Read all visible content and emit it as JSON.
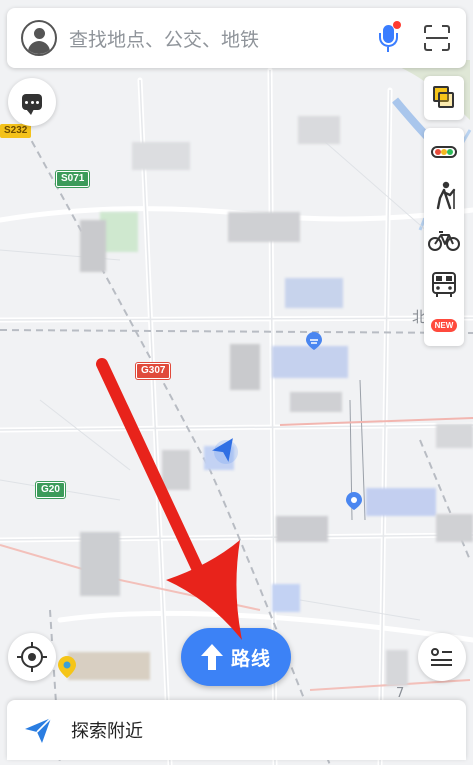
{
  "search": {
    "placeholder": "查找地点、公交、地铁"
  },
  "map": {
    "road_shields": [
      {
        "label": "S232",
        "style": "yellow"
      },
      {
        "label": "S071",
        "style": "green"
      },
      {
        "label": "G307",
        "style": "red"
      },
      {
        "label": "G20",
        "style": "green"
      }
    ],
    "visible_labels": [
      "北",
      "7"
    ]
  },
  "toolbar": {
    "new_badge": "NEW"
  },
  "route_button": {
    "label": "路线"
  },
  "bottom_panel": {
    "nearby_label": "探索附近"
  },
  "colors": {
    "accent": "#3c82f6",
    "annotation_arrow": "#e8231b",
    "badge": "#ff4a3d"
  }
}
